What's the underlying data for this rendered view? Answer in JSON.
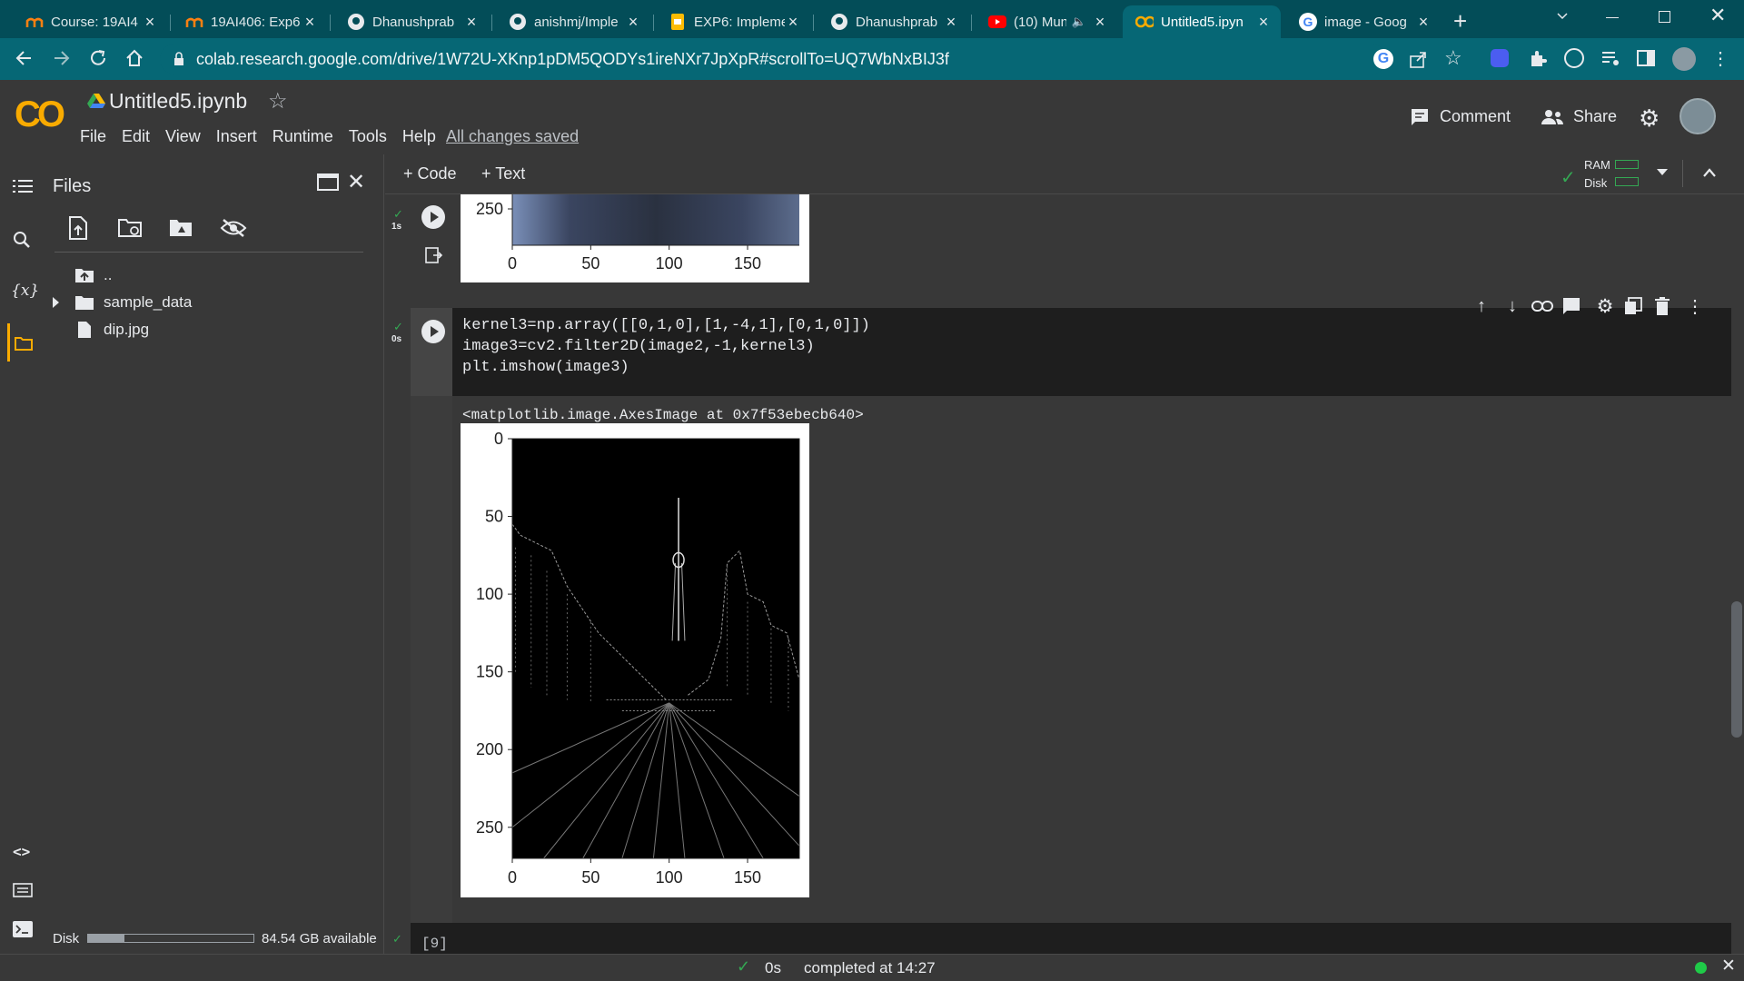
{
  "browser": {
    "tabs": [
      {
        "title": "Course: 19AI4",
        "icon": "moodle-icon"
      },
      {
        "title": "19AI406: Exp6",
        "icon": "moodle-icon"
      },
      {
        "title": "Dhanushprab",
        "icon": "github-icon"
      },
      {
        "title": "anishmj/Imple",
        "icon": "github-icon"
      },
      {
        "title": "EXP6: Impleme",
        "icon": "slides-icon"
      },
      {
        "title": "Dhanushprab",
        "icon": "github-icon"
      },
      {
        "title": "(10) Mun",
        "icon": "youtube-icon"
      },
      {
        "title": "Untitled5.ipyn",
        "icon": "colab-icon",
        "active": true
      },
      {
        "title": "image - Goog",
        "icon": "google-icon"
      }
    ],
    "url": "colab.research.google.com/drive/1W72U-XKnp1pDM5QODYs1ireNXr7JpXpR#scrollTo=UQ7WbNxBIJ3f"
  },
  "header": {
    "logo": "CO",
    "notebook_title": "Untitled5.ipynb",
    "menu": [
      "File",
      "Edit",
      "View",
      "Insert",
      "Runtime",
      "Tools",
      "Help"
    ],
    "save_status": "All changes saved",
    "comment_label": "Comment",
    "share_label": "Share"
  },
  "sidebar": {
    "title": "Files",
    "tree": [
      {
        "name": "..",
        "type": "parent"
      },
      {
        "name": "sample_data",
        "type": "folder"
      },
      {
        "name": "dip.jpg",
        "type": "file"
      }
    ],
    "disk_label": "Disk",
    "disk_available": "84.54 GB available",
    "disk_used_fraction": 0.22
  },
  "toolbar": {
    "add_code": "+ Code",
    "add_text": "+ Text",
    "ram_label": "RAM",
    "disk_label": "Disk"
  },
  "cells": {
    "prev_exec_time": "1s",
    "prev_xticks": [
      "0",
      "50",
      "100",
      "150"
    ],
    "prev_ytick": "250",
    "current_exec_time": "0s",
    "code_lines": [
      "kernel3=np.array([[0,1,0],[1,-4,1],[0,1,0]])",
      "image3=cv2.filter2D(image2,-1,kernel3)",
      "plt.imshow(image3)"
    ],
    "output_text": "<matplotlib.image.AxesImage at 0x7f53ebecb640>",
    "next_cell_label": "[9]"
  },
  "chart_data": {
    "type": "image",
    "title": "",
    "xlabel": "",
    "ylabel": "",
    "xticks": [
      0,
      50,
      100,
      150
    ],
    "yticks": [
      0,
      50,
      100,
      150,
      200,
      250
    ],
    "xlim": [
      0,
      183
    ],
    "ylim": [
      270,
      0
    ],
    "grid": false,
    "legend": "none"
  },
  "status": {
    "elapsed": "0s",
    "completed": "completed at 14:27"
  }
}
